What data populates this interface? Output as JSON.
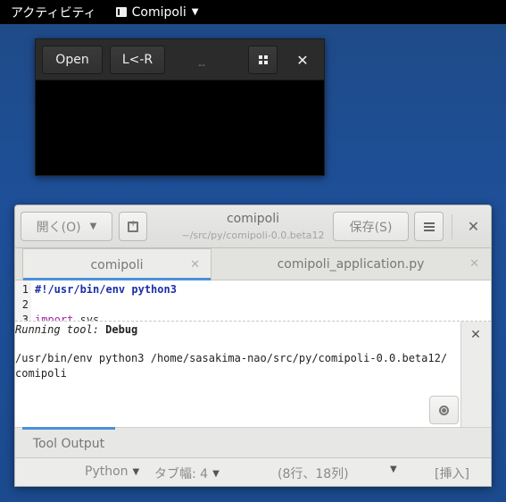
{
  "topbar": {
    "activities": "アクティビティ",
    "app_name": "Comipoli"
  },
  "small_window": {
    "open_label": "Open",
    "lr_label": "L<-R",
    "title": "--"
  },
  "gedit": {
    "open_label": "開く(O)",
    "title": "comipoli",
    "subtitle": "~/src/py/comipoli-0.0.beta12",
    "save_label": "保存(S)",
    "tabs": [
      {
        "label": "comipoli",
        "active": true
      },
      {
        "label": "comipoli_application.py",
        "active": false
      }
    ],
    "lines": [
      {
        "num": "1",
        "text": "#!/usr/bin/env python3"
      },
      {
        "num": "2",
        "text": ""
      },
      {
        "num": "3",
        "kw": "import",
        "rest": " sys"
      }
    ],
    "panel": {
      "running_label": "Running tool:",
      "running_tool": "Debug",
      "command_line1": "/usr/bin/env python3 /home/sasakima-nao/src/py/comipoli-0.0.beta12/",
      "command_line2": "comipoli",
      "tab_label": "Tool Output"
    },
    "status": {
      "language": "Python",
      "tab_width": "タブ幅: 4",
      "position": "(8行、18列)",
      "mode": "[挿入]"
    }
  },
  "colors": {
    "accent": "#4a90d9",
    "desktop": "#1e4f98"
  }
}
